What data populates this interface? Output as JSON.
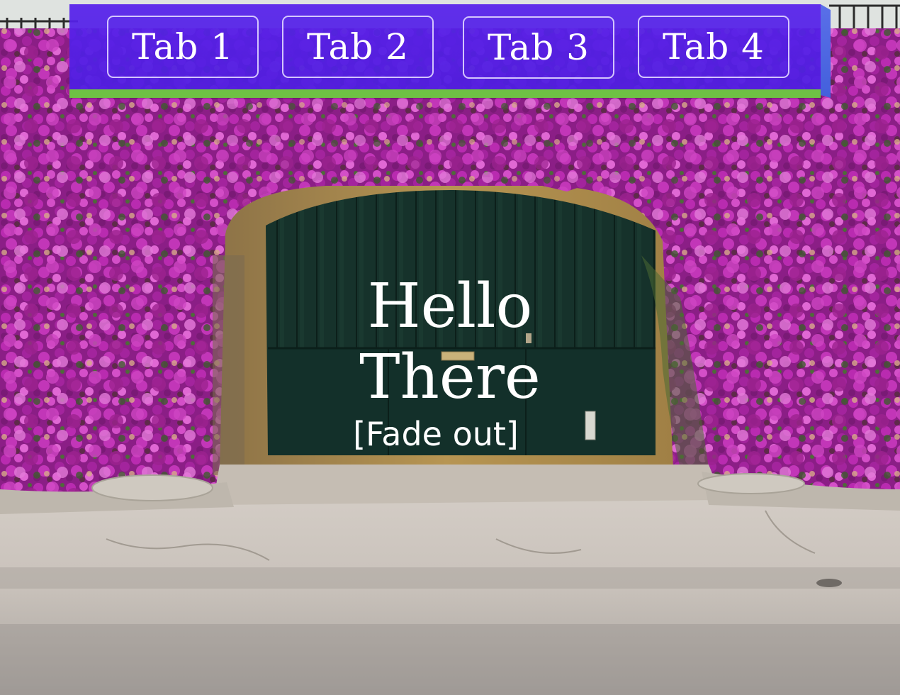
{
  "nav": {
    "tabs": [
      {
        "label": "Tab 1"
      },
      {
        "label": "Tab 2"
      },
      {
        "label": "Tab 3"
      },
      {
        "label": "Tab 4"
      }
    ],
    "bar_color": "#5621eb",
    "accent_color": "#6ec144"
  },
  "hero": {
    "title": "Hello There",
    "caption": "[Fade out]"
  }
}
